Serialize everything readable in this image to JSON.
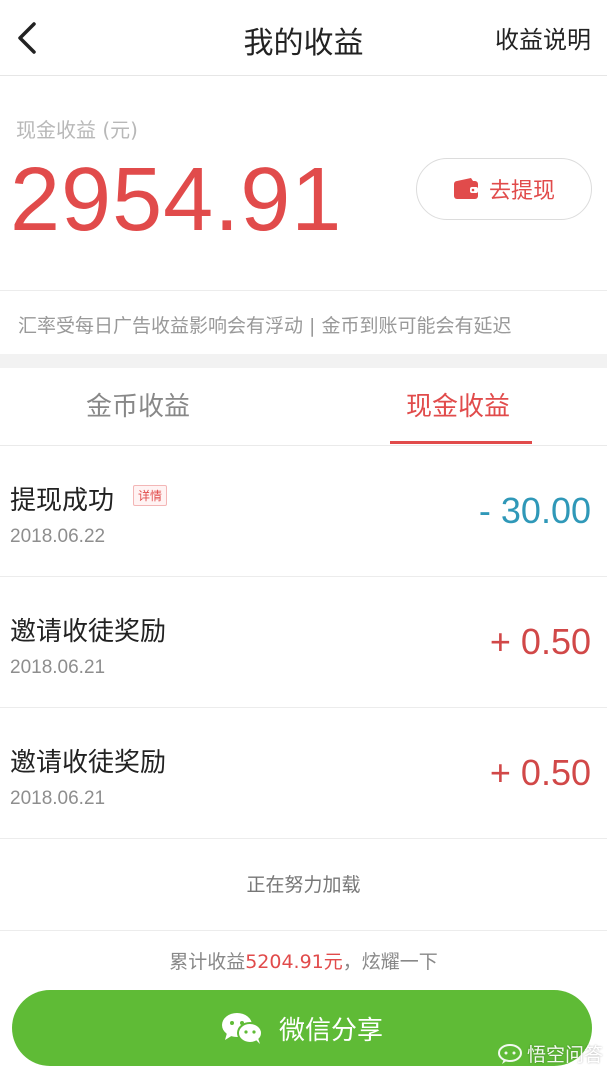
{
  "header": {
    "title": "我的收益",
    "right_link": "收益说明",
    "back_icon": "chevron-left-icon"
  },
  "summary": {
    "cash_label": "现金收益 (元)",
    "cash_amount": "2954.91",
    "withdraw_label": "去提现",
    "withdraw_icon": "wallet-icon"
  },
  "notice": {
    "text": "汇率受每日广告收益影响会有浮动 | 金币到账可能会有延迟"
  },
  "tabs": [
    {
      "label": "金币收益",
      "active": false
    },
    {
      "label": "现金收益",
      "active": true
    }
  ],
  "records": [
    {
      "title": "提现成功",
      "tag": "详情",
      "date": "2018.06.22",
      "amount": "- 30.00",
      "type": "debit"
    },
    {
      "title": "邀请收徒奖励",
      "tag": "",
      "date": "2018.06.21",
      "amount": "+ 0.50",
      "type": "credit"
    },
    {
      "title": "邀请收徒奖励",
      "tag": "",
      "date": "2018.06.21",
      "amount": "+ 0.50",
      "type": "credit"
    }
  ],
  "loading_text": "正在努力加载",
  "total": {
    "prefix": "累计收益",
    "value": "5204.91元",
    "suffix": "，炫耀一下"
  },
  "share": {
    "label": "微信分享",
    "icon": "wechat-icon"
  },
  "watermark": {
    "text": "悟空问答"
  },
  "colors": {
    "accent_red": "#e14b4b",
    "debit_blue": "#2f98b8",
    "share_green": "#5fbb36"
  }
}
